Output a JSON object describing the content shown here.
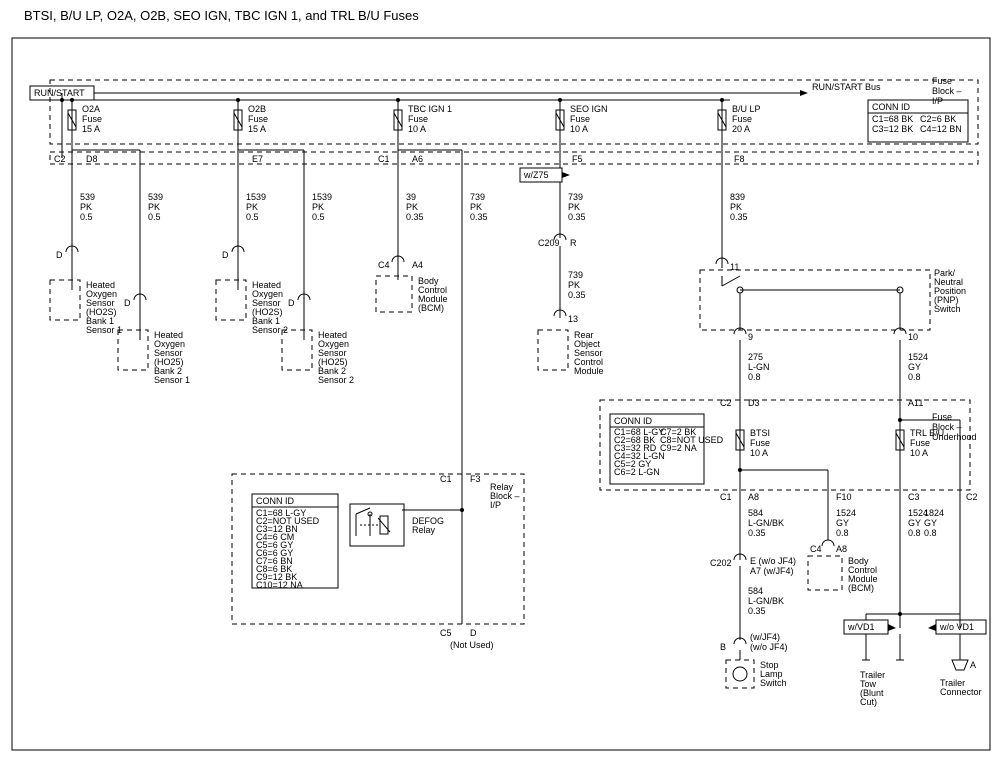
{
  "title": "BTSI, B/U LP, O2A, O2B, SEO IGN, TBC IGN 1, and TRL B/U Fuses",
  "run_start": "RUN/START",
  "run_start_bus": "RUN/START Bus",
  "fuse_block_ip": "Fuse Block – I/P",
  "fuse_block_uh": "Fuse Block – Underhood",
  "relay_block_ip": "Relay Block – I/P",
  "conn_id_ip": {
    "title": "CONN ID",
    "lines": [
      "C1=68 BK",
      "C2=6 BK",
      "C3=12 BK",
      "C4=12 BN"
    ]
  },
  "fuses": {
    "o2a": {
      "name": "O2A",
      "sub": "Fuse",
      "rating": "15 A"
    },
    "o2b": {
      "name": "O2B",
      "sub": "Fuse",
      "rating": "15 A"
    },
    "tbc": {
      "name": "TBC IGN 1",
      "sub": "Fuse",
      "rating": "10 A"
    },
    "seo": {
      "name": "SEO IGN",
      "sub": "Fuse",
      "rating": "10 A"
    },
    "bulp": {
      "name": "B/U LP",
      "sub": "Fuse",
      "rating": "20 A"
    },
    "btsi": {
      "name": "BTSI",
      "sub": "Fuse",
      "rating": "10 A"
    },
    "trl": {
      "name": "TRL B/U",
      "sub": "Fuse",
      "rating": "10 A"
    }
  },
  "wZ75": "w/Z75",
  "pins": {
    "c2": "C2",
    "d8": "D8",
    "e7": "E7",
    "c1": "C1",
    "a6": "A6",
    "f5": "F5",
    "f8": "F8",
    "d": "D",
    "c4": "C4",
    "a4": "A4",
    "c209": "C209",
    "r": "R",
    "thirteen": "13",
    "eleven": "11",
    "nine": "9",
    "ten": "10",
    "d3": "D3",
    "a11": "A11",
    "a8": "A8",
    "f10": "F10",
    "c3": "C3",
    "c202": "C202",
    "e": "E (w/o JF4)",
    "a7": "A7 (w/JF4)",
    "b": "B",
    "a": "A",
    "f3": "F3",
    "c5": "C5",
    "dNotUsed": "D"
  },
  "wires": {
    "w539": {
      "n": "539",
      "c": "PK",
      "g": "0.5"
    },
    "w1539": {
      "n": "1539",
      "c": "PK",
      "g": "0.5"
    },
    "w39": {
      "n": "39",
      "c": "PK",
      "g": "0.35"
    },
    "w739": {
      "n": "739",
      "c": "PK",
      "g": "0.35"
    },
    "w739b": {
      "n": "739",
      "c": "PK",
      "g": "0.35"
    },
    "w839": {
      "n": "839",
      "c": "PK",
      "g": "0.35"
    },
    "w275": {
      "n": "275",
      "c": "L-GN",
      "g": "0.8"
    },
    "w1524": {
      "n": "1524",
      "c": "GY",
      "g": "0.8"
    },
    "w584": {
      "n": "584",
      "c": "L-GN/BK",
      "g": "0.35"
    },
    "w584b": {
      "n": "584",
      "c": "L-GN/BK",
      "g": "0.35"
    },
    "w1524b": {
      "n": "1524",
      "c": "GY",
      "g": "0.8"
    },
    "w1824": {
      "n": "1824",
      "c": "GY",
      "g": "0.8"
    }
  },
  "components": {
    "ho2s_b1s1": [
      "Heated",
      "Oxygen",
      "Sensor",
      "(HO2S)",
      "Bank 1",
      "Sensor 1"
    ],
    "ho2s_b2s1": [
      "Heated",
      "Oxygen",
      "Sensor",
      "(HO25)",
      "Bank 2",
      "Sensor 1"
    ],
    "ho2s_b1s2": [
      "Heated",
      "Oxygen",
      "Sensor",
      "(HO2S)",
      "Bank 1",
      "Sensor 2"
    ],
    "ho2s_b2s2": [
      "Heated",
      "Oxygen",
      "Sensor",
      "(HO25)",
      "Bank 2",
      "Sensor 2"
    ],
    "bcm": [
      "Body",
      "Control",
      "Module",
      "(BCM)"
    ],
    "bcm2": [
      "Body",
      "Control",
      "Module",
      "(BCM)"
    ],
    "rosc": [
      "Rear",
      "Object",
      "Sensor",
      "Control",
      "Module"
    ],
    "pnp": [
      "Park/",
      "Neutral",
      "Position",
      "(PNP)",
      "Switch"
    ],
    "stop": [
      "Stop",
      "Lamp",
      "Switch"
    ],
    "tow": [
      "Trailer",
      "Tow",
      "(Blunt",
      "Cut)"
    ],
    "trailer": [
      "Trailer",
      "Connector"
    ]
  },
  "defog": "DEFOG Relay",
  "notused": "(Not Used)",
  "wJF4": "(w/JF4)",
  "woJF4": "(w/o JF4)",
  "wVD1": "w/VD1",
  "woVD1": "w/o VD1",
  "conn_id_relay": {
    "title": "CONN ID",
    "lines": [
      "C1=68 L-GY",
      "C2=NOT USED",
      "C3=12 BN",
      "C4=6 CM",
      "C5=6 GY",
      "C6=6 GY",
      "C7=6 BN",
      "C8=6 BK",
      "C9=12 BK",
      "C10=12 NA"
    ]
  },
  "conn_id_uh": {
    "title": "CONN ID",
    "lines": [
      "C1=68 L-GY",
      "C2=68 BK",
      "C3=32 RD",
      "C4=32 L-GN",
      "C5=2 GY",
      "C6=2 L-GN",
      "C7=2 BK",
      "C8=NOT USED",
      "C9=2 NA"
    ]
  }
}
